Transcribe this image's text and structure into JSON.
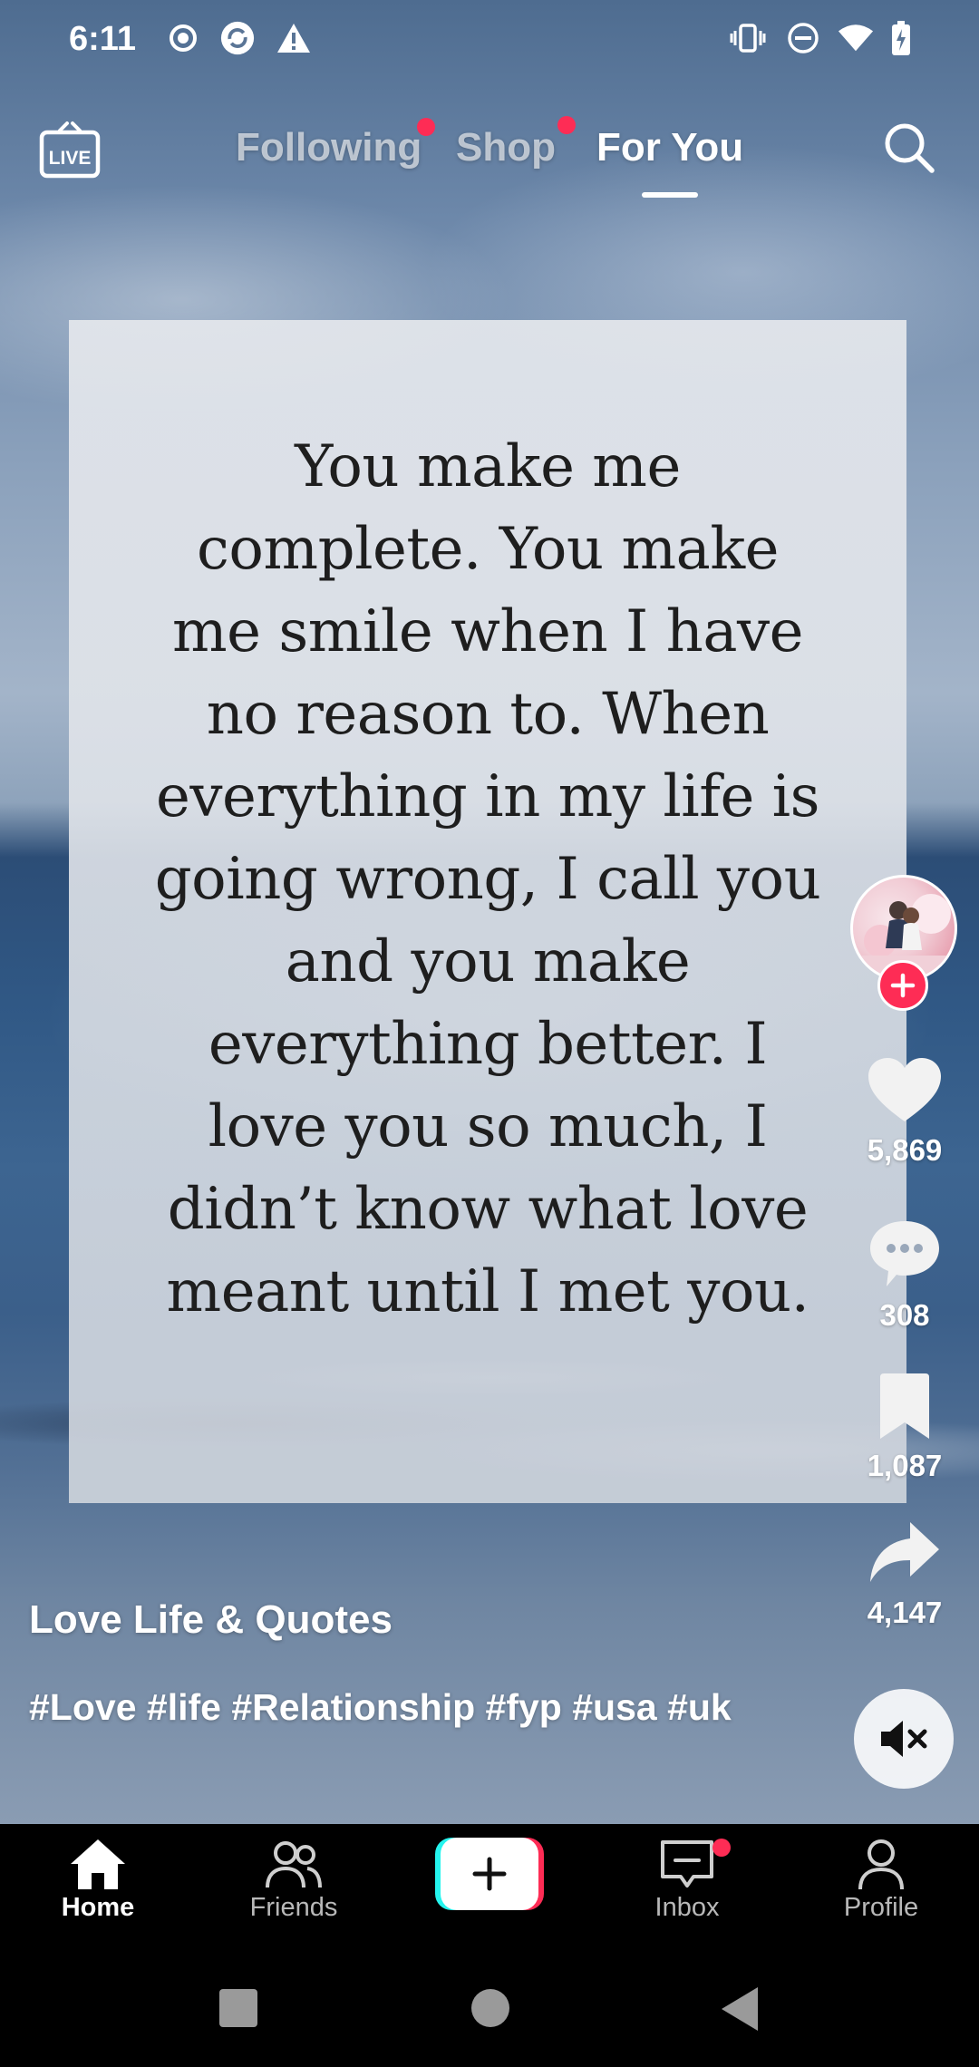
{
  "status_bar": {
    "time": "6:11",
    "left_icons": [
      "record-icon",
      "sync-icon",
      "warning-icon"
    ],
    "right_icons": [
      "vibrate-icon",
      "do-not-disturb-icon",
      "wifi-icon",
      "battery-icon"
    ]
  },
  "top_nav": {
    "live_icon_label": "LIVE",
    "tabs": [
      {
        "label": "Following",
        "has_dot": true,
        "active": false
      },
      {
        "label": "Shop",
        "has_dot": true,
        "active": false
      },
      {
        "label": "For You",
        "has_dot": false,
        "active": true
      }
    ]
  },
  "video": {
    "quote_lines": [
      "You make me",
      "complete. You make",
      "me smile when I have",
      "no reason to. When",
      "everything in my life is",
      "going wrong, I call you",
      "and you make",
      "everything better. I",
      "love you so much, I",
      "didn’t know what love",
      "meant until I met you."
    ],
    "author": "Love Life & Quotes",
    "hashtags": "#Love #life #Relationship #fyp #usa #uk"
  },
  "actions": {
    "likes": "5,869",
    "comments": "308",
    "bookmarks": "1,087",
    "shares": "4,147"
  },
  "bottom_nav": {
    "home": "Home",
    "friends": "Friends",
    "inbox": "Inbox",
    "profile": "Profile"
  },
  "colors": {
    "accent_red": "#fe2c55",
    "accent_cyan": "#25f4ee"
  }
}
